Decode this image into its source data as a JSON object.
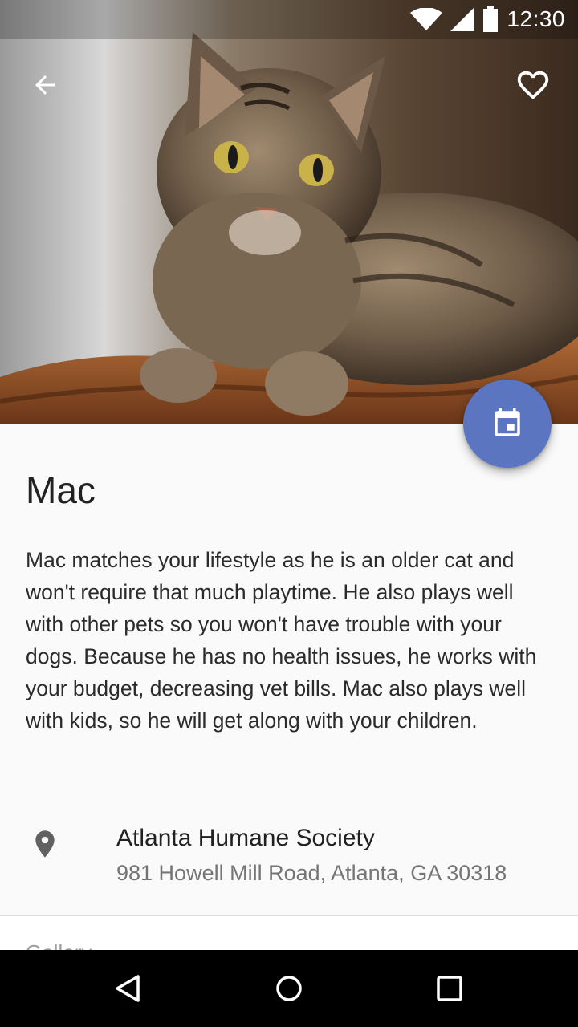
{
  "status_bar": {
    "time": "12:30"
  },
  "pet": {
    "name": "Mac",
    "description": "Mac matches your lifestyle as he is an older cat and won't require that much playtime. He also plays well with other pets so you won't have trouble with your dogs. Because he has no health issues, he works with your budget, decreasing vet bills. Mac also plays well with kids, so he will get along with your children.",
    "photo_alt": "Photo of Mac, a tabby cat"
  },
  "location": {
    "name": "Atlanta Humane Society",
    "address": "981 Howell Mill Road, Atlanta, GA 30318"
  },
  "gallery": {
    "label": "Gallery"
  },
  "icons": {
    "back": "arrow-back-icon",
    "favorite": "heart-outline-icon",
    "fab": "calendar-event-icon",
    "location": "map-pin-icon",
    "nav_back": "triangle-back-icon",
    "nav_home": "circle-home-icon",
    "nav_recents": "square-recents-icon"
  },
  "colors": {
    "fab": "#5c75c1",
    "background": "#fafafa",
    "text_primary": "#212121",
    "text_secondary": "#757575"
  }
}
